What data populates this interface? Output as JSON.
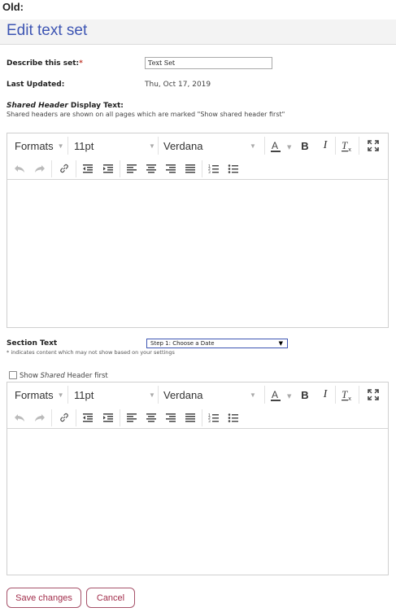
{
  "header": {
    "old_label": "Old:",
    "title": "Edit text set"
  },
  "form": {
    "describe_label": "Describe this set:",
    "required_mark": "*",
    "describe_value": "Text Set",
    "last_updated_label": "Last Updated:",
    "last_updated_value": "Thu, Oct 17, 2019",
    "shared_header_label_italic": "Shared Header",
    "shared_header_label_rest": " Display Text:",
    "shared_header_help": "Shared headers are shown on all pages which are marked \"Show shared header first\"",
    "section_text_label": "Section Text",
    "section_help": "* indicates content which may not show based on your settings",
    "section_select_value": "Step 1: Choose a Date",
    "show_shared_prefix": "Show ",
    "show_shared_italic": "Shared",
    "show_shared_suffix": " Header first"
  },
  "editor_toolbar": {
    "formats": "Formats",
    "font_size": "11pt",
    "font_family": "Verdana",
    "icons": [
      "text-color-icon",
      "bold-icon",
      "italic-icon",
      "clear-formatting-icon",
      "fullscreen-icon",
      "undo-icon",
      "redo-icon",
      "link-icon",
      "outdent-icon",
      "indent-icon",
      "align-left-icon",
      "align-center-icon",
      "align-right-icon",
      "align-justify-icon",
      "numbered-list-icon",
      "bullet-list-icon"
    ]
  },
  "buttons": {
    "save": "Save changes",
    "cancel": "Cancel"
  },
  "colors": {
    "title": "#3d55b3",
    "button_text": "#a12c4a",
    "button_border": "#a7526a"
  }
}
